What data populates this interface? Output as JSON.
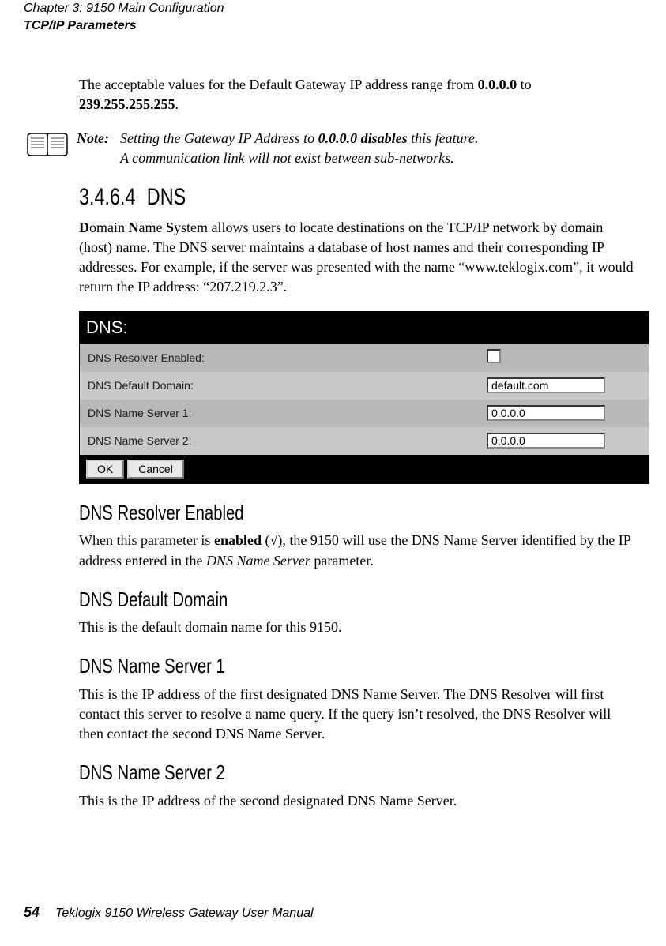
{
  "header": {
    "chapter": "Chapter 3:  9150 Main Configuration",
    "section": "TCP/IP Parameters"
  },
  "intro": {
    "text_before": "The acceptable values for the Default Gateway IP address range from ",
    "range_start": "0.0.0.0",
    "text_mid": " to ",
    "range_end": "239.255.255.255",
    "period": "."
  },
  "note": {
    "label": "Note:",
    "line1_before": "Setting the Gateway IP Address to ",
    "line1_bold": "0.0.0.0 disables",
    "line1_after": " this feature.",
    "line2": "A communication link will not exist between sub-networks."
  },
  "section": {
    "number": "3.4.6.4",
    "title": "DNS"
  },
  "dns_para": {
    "d": "D",
    "omain": "omain ",
    "n": "N",
    "ame": "ame ",
    "s": "S",
    "rest": "ystem allows users to locate destinations on the TCP/IP network by domain (host) name. The DNS server maintains a database of host names and their corresponding IP addresses. For example, if the server was presented with the name “www.teklogix.com”, it would return the IP address: “207.219.2.3”."
  },
  "panel": {
    "title": "DNS:",
    "rows": [
      {
        "label": "DNS Resolver Enabled:",
        "type": "checkbox",
        "value": ""
      },
      {
        "label": "DNS Default Domain:",
        "type": "text",
        "value": "default.com"
      },
      {
        "label": "DNS Name Server 1:",
        "type": "text",
        "value": "0.0.0.0"
      },
      {
        "label": "DNS Name Server 2:",
        "type": "text",
        "value": "0.0.0.0"
      }
    ],
    "ok": "OK",
    "cancel": "Cancel"
  },
  "resolver": {
    "heading": "DNS Resolver Enabled",
    "before": "When this parameter is ",
    "enabled": "enabled",
    "check": " (√), the 9150 will use the DNS Name Server identified by the IP address entered in the ",
    "italic": "DNS Name Server",
    "after": " parameter."
  },
  "default_domain": {
    "heading": "DNS Default Domain",
    "text": "This is the default domain name for this 9150."
  },
  "server1": {
    "heading": "DNS Name Server 1",
    "text": "This is the IP address of the first designated DNS Name Server. The DNS Resolver will first contact this server to resolve a name query. If the query isn’t resolved, the DNS Resolver will then contact the second DNS Name Server."
  },
  "server2": {
    "heading": "DNS Name Server 2",
    "text": "This is the IP address of the second designated DNS Name Server."
  },
  "footer": {
    "page": "54",
    "title": "Teklogix 9150 Wireless Gateway User Manual"
  }
}
